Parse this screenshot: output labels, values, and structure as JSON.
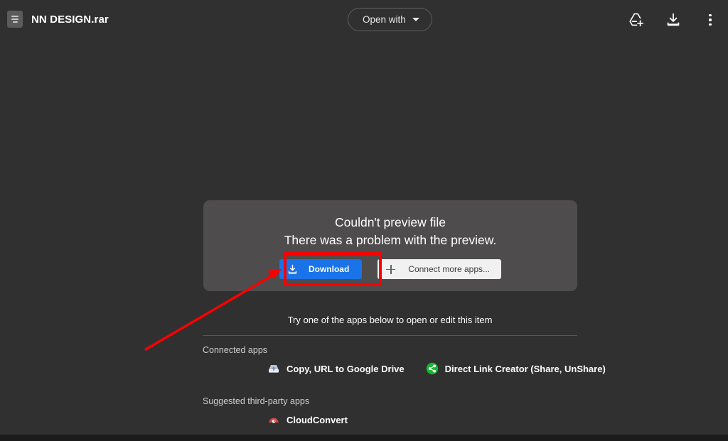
{
  "header": {
    "file_icon": "archive-file-icon",
    "filename": "NN DESIGN.rar",
    "open_with_label": "Open with",
    "add_to_drive_icon": "add-to-drive-icon",
    "download_icon": "download-icon",
    "more_options_icon": "more-vertical-icon"
  },
  "preview_card": {
    "title": "Couldn't preview file",
    "message": "There was a problem with the preview.",
    "download_label": "Download",
    "connect_label": "Connect more apps...",
    "download_color": "#1a73e8",
    "connect_color": "#f1f1f1",
    "card_color": "#4e4c4d"
  },
  "apps": {
    "try_text": "Try one of the apps below to open or edit this item",
    "connected_label": "Connected apps",
    "connected_items": [
      {
        "name": "Copy, URL to Google Drive",
        "icon": "copy-url-drive-icon"
      },
      {
        "name": "Direct Link Creator (Share, UnShare)",
        "icon": "direct-link-creator-icon"
      }
    ],
    "suggested_label": "Suggested third-party apps",
    "suggested_items": [
      {
        "name": "CloudConvert",
        "icon": "cloudconvert-icon"
      }
    ]
  },
  "annotations": {
    "highlight_color": "#fc0000",
    "highlight_target": "Download",
    "arrow_from": "205,492",
    "arrow_to": "392,382"
  },
  "theme": {
    "background": "#303030",
    "text": "#ffffff",
    "divider": "#575757"
  }
}
